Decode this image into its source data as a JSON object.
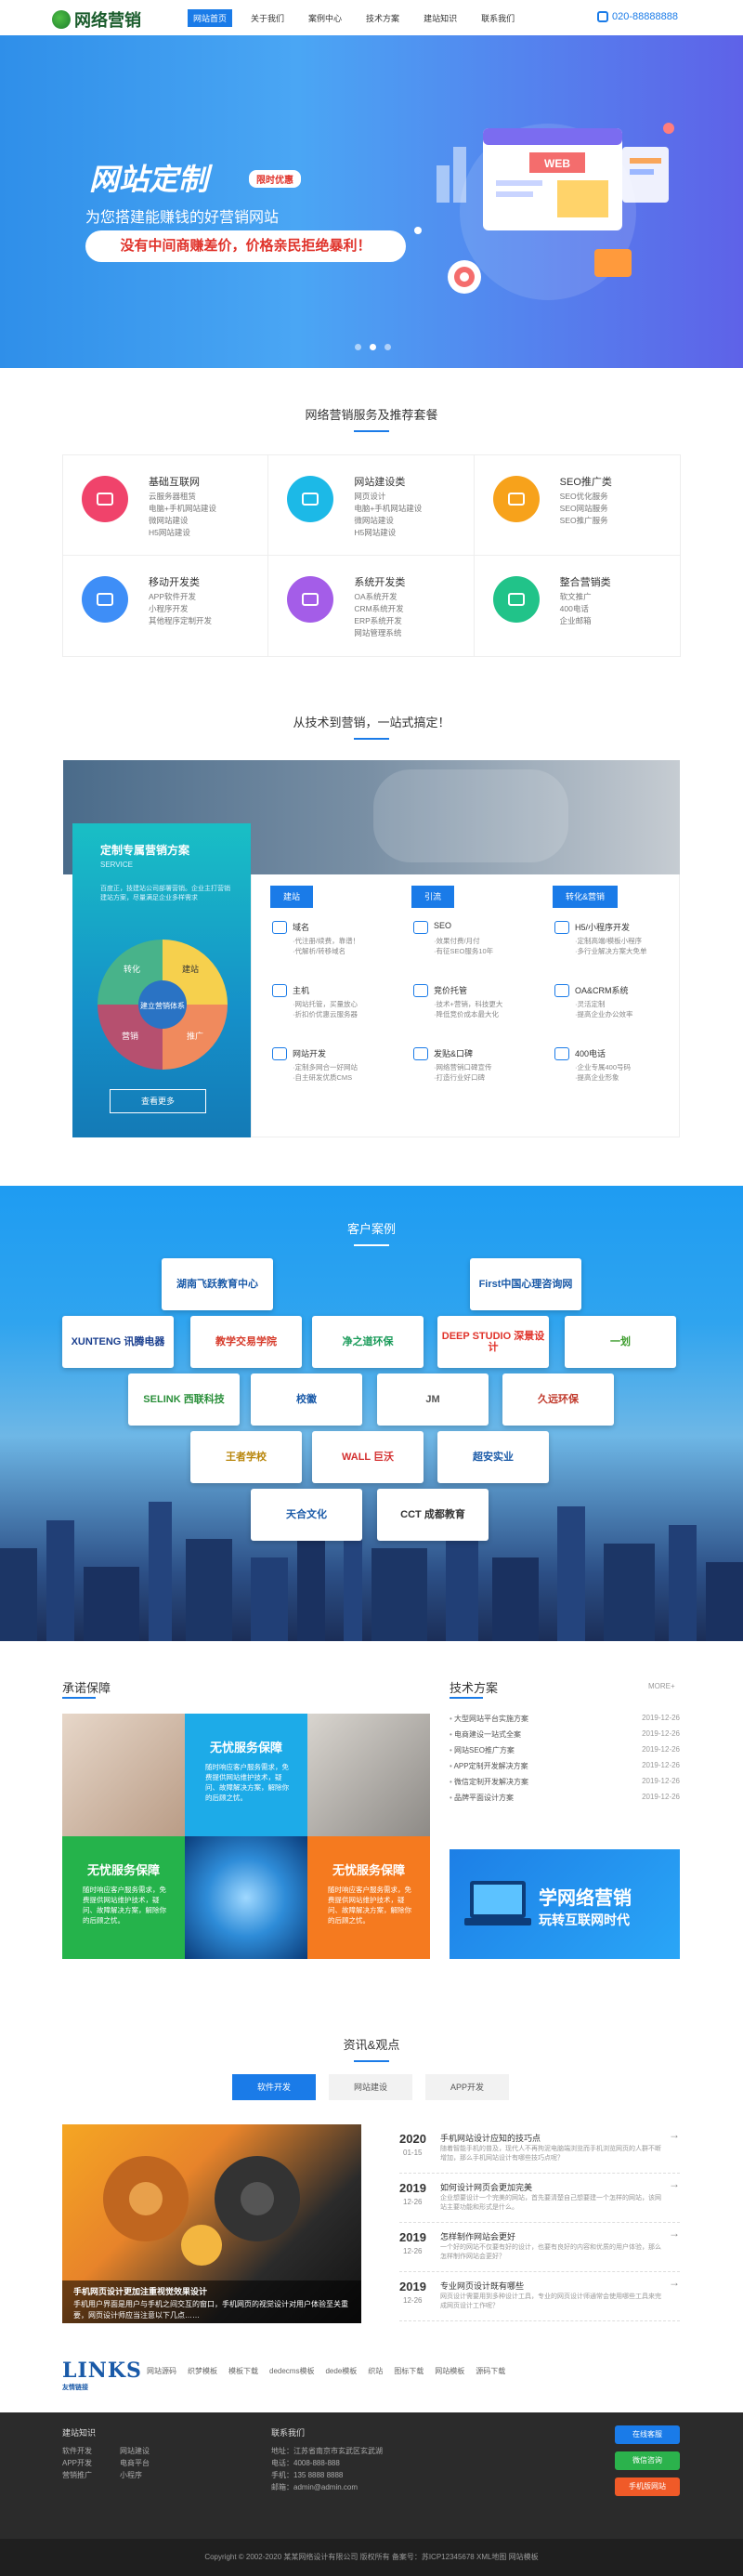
{
  "header": {
    "logo_text": "网络营销",
    "nav": [
      "网站首页",
      "关于我们",
      "案例中心",
      "技术方案",
      "建站知识",
      "联系我们"
    ],
    "phone": "020-88888888"
  },
  "banner": {
    "title": "网站定制",
    "badge": "限时优惠",
    "subtitle": "为您搭建能赚钱的好营销网站",
    "pill": "没有中间商赚差价，价格亲民拒绝暴利！",
    "illustration_text": "WEB"
  },
  "services": {
    "title": "网络营销服务及推荐套餐",
    "items": [
      {
        "name": "基础互联网",
        "color": "#f0436b",
        "lines": [
          "云服务器租赁",
          "电脑+手机网站建设",
          "微网站建设",
          "H5网站建设"
        ]
      },
      {
        "name": "网站建设类",
        "color": "#1cb9e7",
        "lines": [
          "网页设计",
          "电脑+手机网站建设",
          "微网站建设",
          "H5网站建设"
        ]
      },
      {
        "name": "SEO推广类",
        "color": "#f7a21b",
        "lines": [
          "SEO优化服务",
          "SEO网站服务",
          "SEO推广服务"
        ]
      },
      {
        "name": "移动开发类",
        "color": "#3e8ef7",
        "lines": [
          "APP软件开发",
          "小程序开发",
          "其他程序定制开发"
        ]
      },
      {
        "name": "系统开发类",
        "color": "#a45de8",
        "lines": [
          "OA系统开发",
          "CRM系统开发",
          "ERP系统开发",
          "网站管理系统"
        ]
      },
      {
        "name": "整合营销类",
        "color": "#21c389",
        "lines": [
          "软文推广",
          "400电话",
          "企业邮箱"
        ]
      }
    ]
  },
  "tech": {
    "title": "从技术到营销，一站式搞定！",
    "left_title": "定制专属营销方案",
    "left_sub": "SERVICE",
    "left_text": "百度正，技建站公司部署营销。企业主打营销建站方案，尽量满足企业多样需求",
    "left_button": "查看更多",
    "pie_center": "建立营销体系",
    "pie_labels": [
      "建站",
      "推广",
      "营销",
      "转化"
    ],
    "columns": [
      {
        "tag": "建站",
        "tag_color": "#1a7be8",
        "feats": [
          {
            "name": "域名",
            "desc": "·代注册/续费，靠谱！\n·代解析/转移域名"
          },
          {
            "name": "主机",
            "desc": "·网站托管，买量放心\n·折扣价优惠云服务器"
          },
          {
            "name": "网站开发",
            "desc": "·定制多网合一好网站\n·自主研发优质CMS"
          }
        ]
      },
      {
        "tag": "引流",
        "tag_color": "#1a7be8",
        "feats": [
          {
            "name": "SEO",
            "desc": "·效果付费/月付\n·有征SEO服务10年"
          },
          {
            "name": "竞价托管",
            "desc": "·技术+营销，科技更大\n·降低竞价成本最大化"
          },
          {
            "name": "发贴&口碑",
            "desc": "·网络营销口碑宣传\n·打造行业好口碑"
          }
        ]
      },
      {
        "tag": "转化&营销",
        "tag_color": "#1a7be8",
        "feats": [
          {
            "name": "H5/小程序开发",
            "desc": "·定制高端/模板小程序\n·多行业解决方案大免单"
          },
          {
            "name": "OA&CRM系统",
            "desc": "·灵活定制\n·提高企业办公效率"
          },
          {
            "name": "400电话",
            "desc": "·企业专属400号码\n·提高企业形象"
          }
        ]
      }
    ]
  },
  "cases": {
    "title": "客户案例",
    "logos": [
      "湖南飞跃教育中心",
      "First中国心理咨询网",
      "XUNTENG 讯腾电器",
      "教学交易学院",
      "净之道环保",
      "DEEP STUDIO 深景设计",
      "一划",
      "SELINK 西联科技",
      "校徽",
      "JM",
      "久远环保",
      "王者学校",
      "WALL 巨沃",
      "超安实业",
      "天合文化",
      "CCT 成都教育"
    ]
  },
  "promise": {
    "title": "承诺保障",
    "cells": [
      {
        "title": "无忧服务保障",
        "text": "随时响应客户服务需求，免费提供网站维护技术，疑问、故障解决方案，解除你的后顾之忧。"
      },
      {
        "title": "无忧服务保障",
        "text": "随时响应客户服务需求，免费提供网站维护技术，疑问、故障解决方案，解除你的后顾之忧。"
      },
      {
        "title": "无忧服务保障",
        "text": "随时响应客户服务需求，免费提供网站维护技术，疑问、故障解决方案，解除你的后顾之忧。"
      }
    ]
  },
  "solutions": {
    "title": "技术方案",
    "more": "MORE+",
    "items": [
      {
        "title": "大型网站平台实施方案",
        "date": "2019-12-26"
      },
      {
        "title": "电商建设一站式全案",
        "date": "2019-12-26"
      },
      {
        "title": "网站SEO推广方案",
        "date": "2019-12-26"
      },
      {
        "title": "APP定制开发解决方案",
        "date": "2019-12-26"
      },
      {
        "title": "微信定制开发解决方案",
        "date": "2019-12-26"
      },
      {
        "title": "品牌平面设计方案",
        "date": "2019-12-26"
      }
    ],
    "banner_line1": "学网络营销",
    "banner_line2": "玩转互联网时代"
  },
  "news": {
    "title": "资讯&观点",
    "tabs": [
      "软件开发",
      "网站建设",
      "APP开发"
    ],
    "feature_title": "手机网页设计更加注重视觉效果设计",
    "feature_text": "手机用户界面是用户与手机之间交互的窗口，手机网页的视觉设计对用户体验至关重要，网页设计师应当注意以下几点……",
    "items": [
      {
        "year": "2020",
        "date": "01-15",
        "title": "手机网站设计应知的技巧点",
        "desc": "随着智能手机的普及，现代人不再拘泥电脑端浏览而手机浏览网页的人群不断增加，那么手机网站设计有哪些技巧点呢？"
      },
      {
        "year": "2019",
        "date": "12-26",
        "title": "如何设计网页会更加完美",
        "desc": "企业想要设计一个完美的网站，首先要清楚自己想要建一个怎样的网站，该网站主要功能和形式是什么。"
      },
      {
        "year": "2019",
        "date": "12-26",
        "title": "怎样制作网站会更好",
        "desc": "一个好的网站不仅要有好的设计，也要有良好的内容和优质的用户体验，那么怎样制作网站会更好？"
      },
      {
        "year": "2019",
        "date": "12-26",
        "title": "专业网页设计既有哪些",
        "desc": "网页设计需要用到多种设计工具，专业的网页设计师通常会使用哪些工具来完成网页设计工作呢？"
      }
    ]
  },
  "links": {
    "logo": "LINKS",
    "logo_sub": "友情链接",
    "items": [
      "网站源码",
      "织梦模板",
      "模板下载",
      "dedecms模板",
      "dede模板",
      "织站",
      "图标下载",
      "网站模板",
      "源码下载"
    ]
  },
  "footer": {
    "col1_title": "建站知识",
    "col1_links": [
      "软件开发",
      "网站建设",
      "APP开发",
      "电商平台",
      "营销推广",
      "小程序"
    ],
    "col2_title": "联系我们",
    "col2_lines": [
      "地址：江苏省南京市玄武区玄武湖",
      "电话：4008-888-888",
      "手机：135 8888 8888",
      "邮箱：admin@admin.com"
    ],
    "buttons": [
      {
        "label": "在线客服",
        "color": "#1a7be8"
      },
      {
        "label": "微信咨询",
        "color": "#2bb24c"
      },
      {
        "label": "手机版网站",
        "color": "#f05a28"
      }
    ],
    "copyright": "Copyright © 2002-2020 某某网络设计有限公司 版权所有  备案号：苏ICP12345678  XML地图  网站模板"
  }
}
